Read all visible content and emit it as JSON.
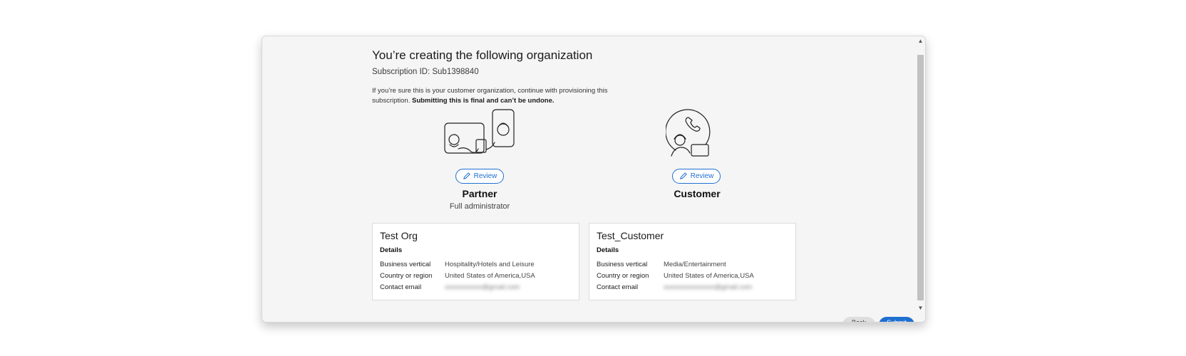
{
  "dialog": {
    "title": "You’re creating the following organization",
    "subscription": "Subscription ID: Sub1398840",
    "intro_text": "If you’re sure this is your customer organization, continue with provisioning this subscription.",
    "intro_bold": "Submitting this is final and can’t be undone."
  },
  "partner": {
    "review_label": "Review",
    "role": "Partner",
    "role_subtitle": "Full administrator",
    "org_name": "Test Org",
    "details_label": "Details",
    "rows": [
      {
        "label": "Business vertical",
        "value": "Hospitality/Hotels and Leisure"
      },
      {
        "label": "Country or region",
        "value": "United States of America,USA"
      },
      {
        "label": "Contact email",
        "value": "xxxxxxxxxxx@gmail.com"
      }
    ]
  },
  "customer": {
    "review_label": "Review",
    "role": "Customer",
    "org_name": "Test_Customer",
    "details_label": "Details",
    "rows": [
      {
        "label": "Business vertical",
        "value": "Media/Entertainment"
      },
      {
        "label": "Country or region",
        "value": "United States of America,USA"
      },
      {
        "label": "Contact email",
        "value": "xxxxxxxxxxxxxxx@gmail.com"
      }
    ]
  },
  "footer": {
    "back_label": "Back",
    "submit_label": "Submit"
  },
  "icons": {
    "partner_illustration": "partner-illustration-icon",
    "customer_illustration": "customer-illustration-icon",
    "pencil": "pencil-icon"
  },
  "colors": {
    "accent": "#1f6fd1",
    "dialog_bg": "#f5f5f5"
  }
}
